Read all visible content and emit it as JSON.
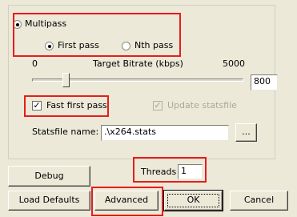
{
  "multipass": {
    "label": "Multipass",
    "checked": true,
    "first_pass_label": "First pass",
    "nth_pass_label": "Nth pass",
    "selected_pass": "First pass"
  },
  "bitrate": {
    "min_label": "0",
    "title": "Target Bitrate (kbps)",
    "max_label": "5000",
    "value": "800",
    "slider_value": 800,
    "slider_min": 0,
    "slider_max": 5000
  },
  "options": {
    "fast_first_pass_label": "Fast first pass",
    "fast_first_pass_checked": true,
    "update_statsfile_label": "Update statsfile",
    "update_statsfile_checked": true,
    "update_statsfile_enabled": false
  },
  "statsfile": {
    "label": "Statsfile name:",
    "value": ".\\x264.stats",
    "browse_label": "..."
  },
  "buttons": {
    "debug": "Debug",
    "threads_label": "Threads",
    "threads_value": "1",
    "load_defaults": "Load Defaults",
    "advanced": "Advanced",
    "ok": "OK",
    "cancel": "Cancel"
  },
  "colors": {
    "highlight_box": "#e81c1c",
    "dialog_background": "#ece9d8"
  }
}
